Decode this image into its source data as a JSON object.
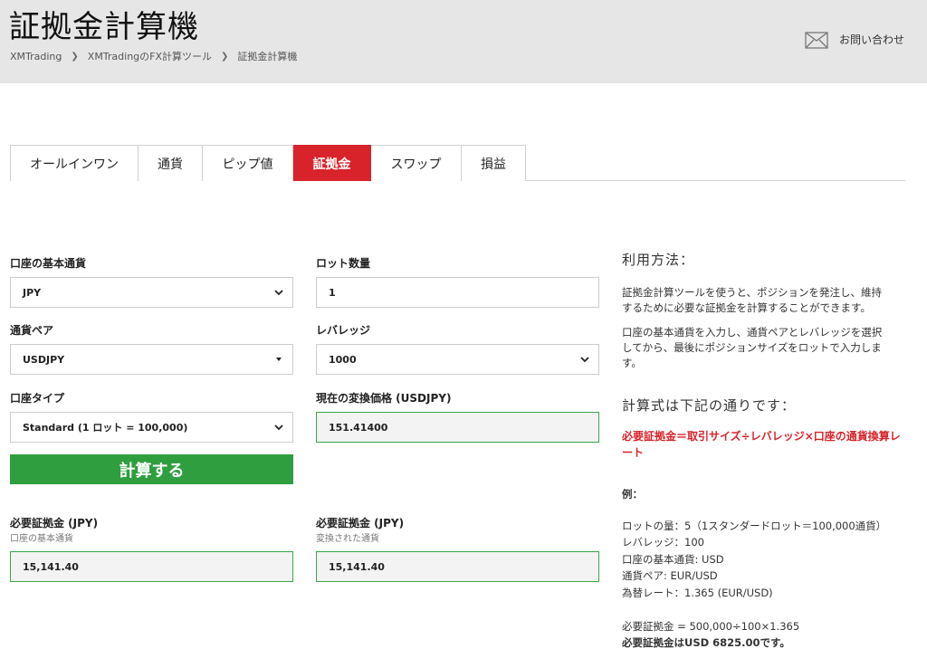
{
  "header": {
    "title": "証拠金計算機",
    "breadcrumb": [
      "XMTrading",
      "XMTradingのFX計算ツール",
      "証拠金計算機"
    ],
    "contact_label": "お問い合わせ"
  },
  "tabs": [
    {
      "label": "オールインワン",
      "active": false
    },
    {
      "label": "通貨",
      "active": false
    },
    {
      "label": "ピップ値",
      "active": false
    },
    {
      "label": "証拠金",
      "active": true
    },
    {
      "label": "スワップ",
      "active": false
    },
    {
      "label": "損益",
      "active": false
    }
  ],
  "form": {
    "base_currency": {
      "label": "口座の基本通貨",
      "value": "JPY"
    },
    "currency_pair": {
      "label": "通貨ペア",
      "value": "USDJPY"
    },
    "account_type": {
      "label": "口座タイプ",
      "value": "Standard (1 ロット = 100,000)"
    },
    "lot_size": {
      "label": "ロット数量",
      "value": "1"
    },
    "leverage": {
      "label": "レバレッジ",
      "value": "1000"
    },
    "conversion_price": {
      "label": "現在の変換価格 (USDJPY)",
      "value": "151.41400"
    },
    "calculate_label": "計算する"
  },
  "results": {
    "left": {
      "label": "必要証拠金 (JPY)",
      "sub": "口座の基本通貨",
      "value": "15,141.40"
    },
    "right": {
      "label": "必要証拠金 (JPY)",
      "sub": "変換された通貨",
      "value": "15,141.40"
    }
  },
  "howto": {
    "title": "利用方法：",
    "para1_line1": "証拠金計算ツールを使うと、ポジションを発注し、維持",
    "para1_line2": "するために必要な証拠金を計算することができます。",
    "para2_line1": "口座の基本通貨を入力し、通貨ペアとレバレッジを選択",
    "para2_line2": "してから、最後にポジションサイズをロットで入力しま",
    "para2_line3": "す。",
    "formula_title": "計算式は下記の通りです：",
    "formula_line1": "必要証拠金＝取引サイズ÷レバレッジ×口座の通貨換算レ",
    "formula_line2": "ート",
    "example_title": "例：",
    "example_lines": [
      "ロットの量：5（1スタンダードロット＝100,000通貨）",
      "レバレッジ：100",
      "口座の基本通貨: USD",
      "通貨ペア: EUR/USD",
      "為替レート：1.365 (EUR/USD)"
    ],
    "calc_line": "必要証拠金 = 500,000÷100×1.365",
    "result_line": "必要証拠金はUSD 6825.00です。"
  },
  "colors": {
    "accent_red": "#d8232a",
    "button_green": "#2e9e3e",
    "field_border_green": "#3aa64a"
  },
  "icons": {
    "contact": "mail-icon",
    "select": "chevron-down-icon",
    "breadcrumb_sep": "chevron-right-icon"
  }
}
